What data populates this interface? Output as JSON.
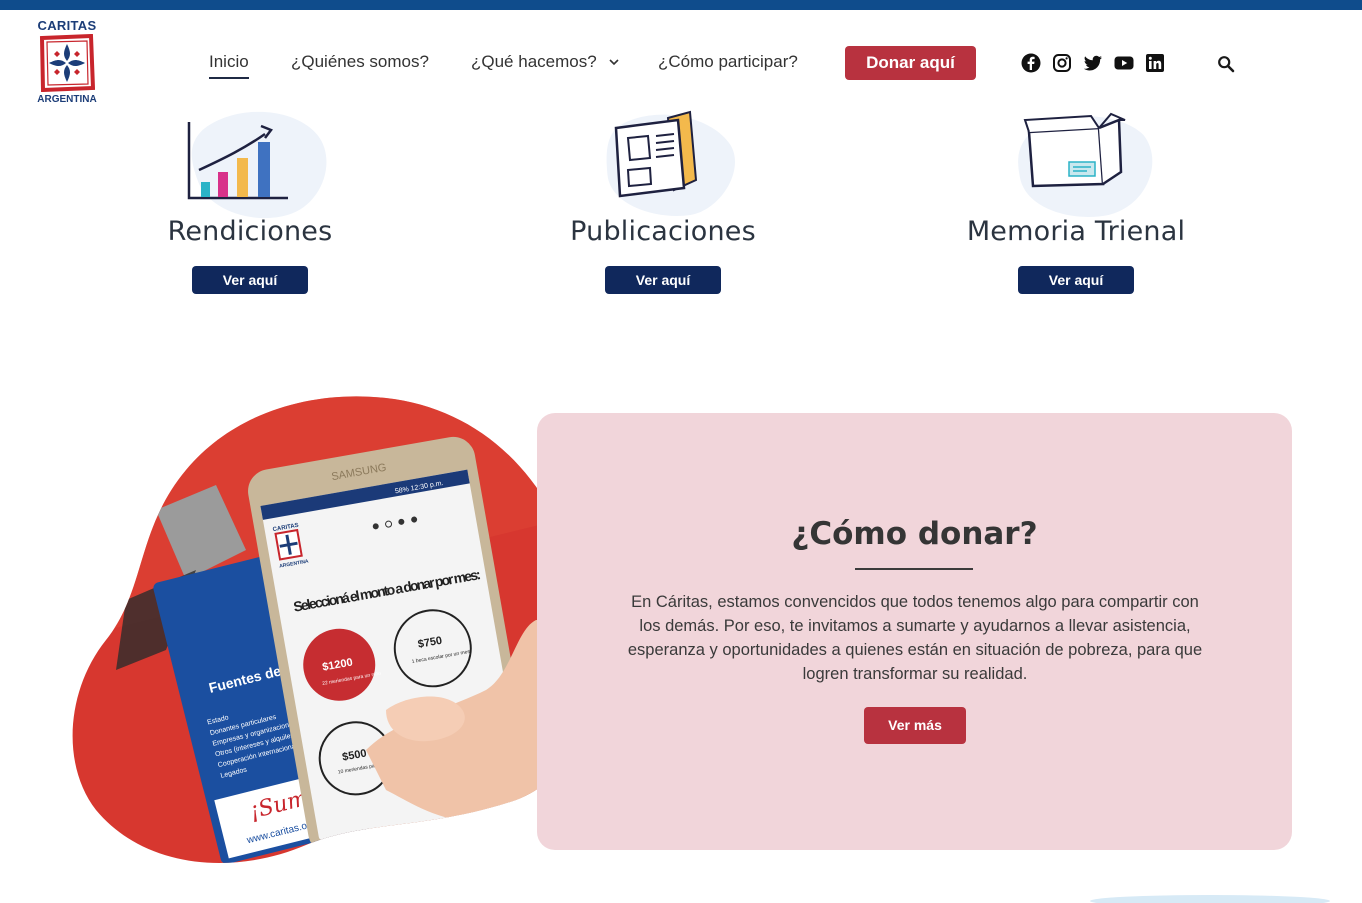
{
  "brand": {
    "name_top": "CARITAS",
    "name_bottom": "ARGENTINA",
    "primary_color": "#10285c",
    "accent_color": "#b8323f",
    "strip_color": "#0f4c8c"
  },
  "nav": {
    "items": [
      {
        "label": "Inicio",
        "active": true
      },
      {
        "label": "¿Quiénes somos?"
      },
      {
        "label": "¿Qué hacemos?",
        "has_dropdown": true
      },
      {
        "label": "¿Cómo participar?"
      }
    ],
    "donate_label": "Donar aquí",
    "social_icons": [
      "facebook-icon",
      "instagram-icon",
      "twitter-icon",
      "youtube-icon",
      "linkedin-icon"
    ],
    "search_icon": "search-icon"
  },
  "cards": [
    {
      "title": "Rendiciones",
      "button": "Ver aquí",
      "icon": "chart-growth-icon"
    },
    {
      "title": "Publicaciones",
      "button": "Ver aquí",
      "icon": "newspaper-icon"
    },
    {
      "title": "Memoria Trienal",
      "button": "Ver aquí",
      "icon": "box-icon"
    }
  ],
  "donate_section": {
    "title": "¿Cómo donar?",
    "text": "En Cáritas, estamos convencidos que todos tenemos algo para compartir con los demás. Por eso, te invitamos a sumarte y ayudarnos a llevar asistencia, esperanza y oportunidades a quienes están en situación de pobreza, para que logren transformar su realidad.",
    "button": "Ver más",
    "panel_color": "#f1d5da"
  },
  "photo": {
    "phone_heading": "Seleccioná el monto a donar por mes:",
    "phone_amounts": [
      {
        "amount": "$1200",
        "note": "22 meriendas para un niño"
      },
      {
        "amount": "$750",
        "note": "1 beca escolar por un mes"
      },
      {
        "amount": "$500",
        "note": "10 meriendas para un niño/a"
      }
    ],
    "card_heading": "Fuentes de financiamiento",
    "card_items": [
      "Estado",
      "Donantes particulares",
      "Empresas y organizaciones",
      "Otros (intereses y alquileres)",
      "Cooperación internacional",
      "Legados"
    ],
    "card_slogan": "¡Sumate!",
    "card_url": "www.caritas.org.ar",
    "phone_brand": "SAMSUNG",
    "phone_status": "58% 12:30 p.m.",
    "phone_logo_top": "CARITAS",
    "phone_logo_bottom": "ARGENTINA"
  }
}
